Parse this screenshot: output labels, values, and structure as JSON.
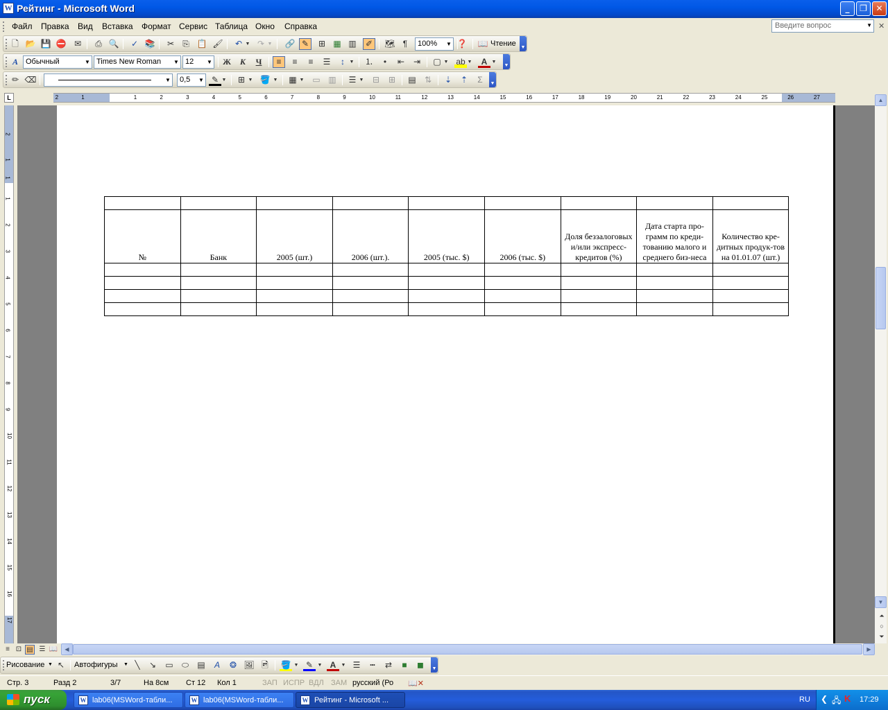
{
  "window": {
    "title": "Рейтинг - Microsoft Word",
    "app_icon": "W"
  },
  "menu": {
    "items": [
      "Файл",
      "Правка",
      "Вид",
      "Вставка",
      "Формат",
      "Сервис",
      "Таблица",
      "Окно",
      "Справка"
    ],
    "help_placeholder": "Введите вопрос"
  },
  "standard_toolbar": {
    "zoom": "100%",
    "reading_label": "Чтение"
  },
  "formatting_toolbar": {
    "style": "Обычный",
    "font": "Times New Roman",
    "size": "12",
    "bold": "Ж",
    "italic": "К",
    "underline": "Ч"
  },
  "tables_toolbar": {
    "line_weight": "0,5",
    "sum_icon": "Σ"
  },
  "ruler": {
    "h_numbers": [
      "2",
      "1",
      "1",
      "2",
      "3",
      "4",
      "5",
      "6",
      "7",
      "8",
      "9",
      "10",
      "11",
      "12",
      "13",
      "14",
      "15",
      "16",
      "17",
      "18",
      "19",
      "20",
      "21",
      "22",
      "23",
      "24",
      "25",
      "26",
      "27"
    ],
    "v_numbers": [
      "2",
      "1",
      "1",
      "1",
      "2",
      "3",
      "4",
      "5",
      "6",
      "7",
      "8",
      "9",
      "10",
      "11",
      "12",
      "13",
      "14",
      "15",
      "16",
      "17"
    ],
    "tab_symbol": "L"
  },
  "document": {
    "table": {
      "header": [
        "№",
        "Банк",
        "2005 (шт.)",
        "2006 (шт.).",
        "2005 (тыс. $)",
        "2006 (тыс. $)",
        "Доля беззалоговых и/или экспресс-кредитов (%)",
        "Дата старта про-грамм по креди-тованию малого и среднего биз-неса",
        "Количество кре-дитных продук-тов на 01.01.07 (шт.)"
      ],
      "empty_rows": 4,
      "columns": 9
    }
  },
  "drawing_toolbar": {
    "draw_label": "Рисование",
    "autoshapes_label": "Автофигуры"
  },
  "status": {
    "page": "Стр. 3",
    "section": "Разд 2",
    "pages": "3/7",
    "at": "На 8см",
    "line": "Ст 12",
    "col": "Кол 1",
    "rec": "ЗАП",
    "trk": "ИСПР",
    "ext": "ВДЛ",
    "ovr": "ЗАМ",
    "lang": "русский (Ро"
  },
  "taskbar": {
    "start": "пуск",
    "tasks": [
      "lab06(MSWord-табли...",
      "lab06(MSWord-табли...",
      "Рейтинг - Microsoft ..."
    ],
    "lang": "RU",
    "clock": "17:29"
  }
}
